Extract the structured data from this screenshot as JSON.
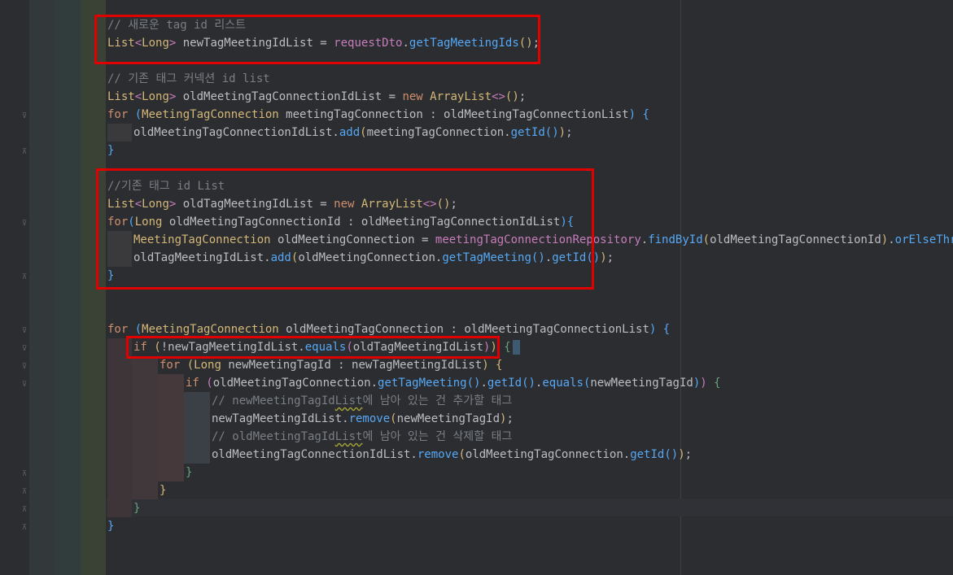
{
  "editor": {
    "lines": [
      {
        "id": "l1",
        "segs": [
          [
            "cmt",
            "// 새로운 tag id 리스트"
          ]
        ]
      },
      {
        "id": "l2",
        "segs": [
          [
            "ylw",
            "List"
          ],
          [
            "br2",
            "<"
          ],
          [
            "ylw",
            "Long"
          ],
          [
            "br2",
            "> "
          ],
          [
            "pl",
            "newTagMeetingIdList = "
          ],
          [
            "fld",
            "requestDto"
          ],
          [
            "pl",
            "."
          ],
          [
            "fn",
            "getTagMeetingIds"
          ],
          [
            "br1",
            "()"
          ],
          [
            "pl",
            ";"
          ]
        ]
      },
      {
        "id": "l3",
        "segs": []
      },
      {
        "id": "l4",
        "segs": [
          [
            "cmt",
            "// 기존 태그 커넥션 id list"
          ]
        ]
      },
      {
        "id": "l5",
        "segs": [
          [
            "ylw",
            "List"
          ],
          [
            "br2",
            "<"
          ],
          [
            "ylw",
            "Long"
          ],
          [
            "br2",
            "> "
          ],
          [
            "pl",
            "oldMeetingTagConnectionIdList = "
          ],
          [
            "kw",
            "new "
          ],
          [
            "ylw",
            "ArrayList"
          ],
          [
            "br2",
            "<>"
          ],
          [
            "br1",
            "()"
          ],
          [
            "pl",
            ";"
          ]
        ]
      },
      {
        "id": "l6",
        "segs": [
          [
            "kw",
            "for "
          ],
          [
            "br3",
            "("
          ],
          [
            "ylw",
            "MeetingTagConnection "
          ],
          [
            "pl",
            "meetingTagConnection : oldMeetingTagConnectionList"
          ],
          [
            "br3",
            ") "
          ],
          [
            "br3",
            "{"
          ]
        ]
      },
      {
        "id": "l7",
        "segs": [
          [
            "pl",
            "oldMeetingTagConnectionIdList."
          ],
          [
            "fn",
            "add"
          ],
          [
            "br1",
            "("
          ],
          [
            "pl",
            "meetingTagConnection."
          ],
          [
            "fn",
            "getId"
          ],
          [
            "br3",
            "()"
          ],
          [
            "br1",
            ")"
          ],
          [
            "pl",
            ";"
          ]
        ]
      },
      {
        "id": "l8",
        "segs": [
          [
            "br3",
            "}"
          ]
        ]
      },
      {
        "id": "l9",
        "segs": []
      },
      {
        "id": "l10",
        "segs": [
          [
            "cmt",
            "//기존 태그 id List"
          ]
        ]
      },
      {
        "id": "l11",
        "segs": [
          [
            "ylw",
            "List"
          ],
          [
            "br2",
            "<"
          ],
          [
            "ylw",
            "Long"
          ],
          [
            "br2",
            "> "
          ],
          [
            "pl",
            "oldTagMeetingIdList = "
          ],
          [
            "kw",
            "new "
          ],
          [
            "ylw",
            "ArrayList"
          ],
          [
            "br2",
            "<>"
          ],
          [
            "br1",
            "()"
          ],
          [
            "pl",
            ";"
          ]
        ]
      },
      {
        "id": "l12",
        "segs": [
          [
            "kw",
            "for"
          ],
          [
            "br3",
            "("
          ],
          [
            "ylw",
            "Long "
          ],
          [
            "pl",
            "oldMeetingTagConnectionId : oldMeetingTagConnectionIdList"
          ],
          [
            "br3",
            ")"
          ],
          [
            "br3",
            "{"
          ]
        ]
      },
      {
        "id": "l13",
        "segs": [
          [
            "ylw",
            "MeetingTagConnection "
          ],
          [
            "pl",
            "oldMeetingConnection = "
          ],
          [
            "fld",
            "meetingTagConnectionRepository"
          ],
          [
            "pl",
            "."
          ],
          [
            "fn",
            "findById"
          ],
          [
            "br1",
            "("
          ],
          [
            "pl",
            "oldMeetingTagConnectionId"
          ],
          [
            "br1",
            ")"
          ],
          [
            "pl",
            "."
          ],
          [
            "fn",
            "orElseThrow"
          ],
          [
            "br1",
            "()"
          ],
          [
            "pl",
            ";"
          ]
        ]
      },
      {
        "id": "l14",
        "segs": [
          [
            "pl",
            "oldTagMeetingIdList."
          ],
          [
            "fn",
            "add"
          ],
          [
            "br1",
            "("
          ],
          [
            "pl",
            "oldMeetingConnection."
          ],
          [
            "fn",
            "getTagMeeting"
          ],
          [
            "br3",
            "()"
          ],
          [
            "pl",
            "."
          ],
          [
            "fn",
            "getId"
          ],
          [
            "br3",
            "()"
          ],
          [
            "br1",
            ")"
          ],
          [
            "pl",
            ";"
          ]
        ]
      },
      {
        "id": "l15",
        "segs": [
          [
            "br3",
            "}"
          ]
        ]
      },
      {
        "id": "l16",
        "segs": []
      },
      {
        "id": "l17",
        "segs": []
      },
      {
        "id": "l18",
        "segs": [
          [
            "kw",
            "for "
          ],
          [
            "br3",
            "("
          ],
          [
            "ylw",
            "MeetingTagConnection "
          ],
          [
            "pl",
            "oldMeetingTagConnection : oldMeetingTagConnectionList"
          ],
          [
            "br3",
            ") "
          ],
          [
            "br3",
            "{"
          ]
        ]
      },
      {
        "id": "l19",
        "segs": [
          [
            "kw",
            "if "
          ],
          [
            "br1",
            "("
          ],
          [
            "pl",
            "!newTagMeetingIdList."
          ],
          [
            "fn",
            "equals"
          ],
          [
            "br2",
            "("
          ],
          [
            "pl",
            "oldTagMeetingIdList"
          ],
          [
            "br2",
            ")"
          ],
          [
            "br1",
            ") "
          ],
          [
            "br4",
            "{"
          ]
        ]
      },
      {
        "id": "l20",
        "segs": [
          [
            "kw",
            "for "
          ],
          [
            "br1",
            "("
          ],
          [
            "ylw",
            "Long "
          ],
          [
            "pl",
            "newMeetingTagId : newTagMeetingIdList"
          ],
          [
            "br1",
            ") "
          ],
          [
            "br1",
            "{"
          ]
        ]
      },
      {
        "id": "l21",
        "segs": [
          [
            "kw",
            "if "
          ],
          [
            "br2",
            "("
          ],
          [
            "pl",
            "oldMeetingTagConnection."
          ],
          [
            "fn",
            "getTagMeeting"
          ],
          [
            "br3",
            "()"
          ],
          [
            "pl",
            "."
          ],
          [
            "fn",
            "getId"
          ],
          [
            "br3",
            "()"
          ],
          [
            "pl",
            "."
          ],
          [
            "fn",
            "equals"
          ],
          [
            "br3",
            "("
          ],
          [
            "pl",
            "newMeetingTagId"
          ],
          [
            "br3",
            ")"
          ],
          [
            "br2",
            ") "
          ],
          [
            "br4",
            "{"
          ]
        ]
      },
      {
        "id": "l22",
        "segs": [
          [
            "cmt",
            "// newMeetingTagId"
          ],
          [
            "cmtw",
            "List"
          ],
          [
            "cmt",
            "에 남아 있는 건 추가할 태그"
          ]
        ]
      },
      {
        "id": "l23",
        "segs": [
          [
            "pl",
            "newTagMeetingIdList."
          ],
          [
            "fn",
            "remove"
          ],
          [
            "br1",
            "("
          ],
          [
            "pl",
            "newMeetingTagId"
          ],
          [
            "br1",
            ")"
          ],
          [
            "pl",
            ";"
          ]
        ]
      },
      {
        "id": "l24",
        "segs": [
          [
            "cmt",
            "// oldMeetingTagId"
          ],
          [
            "cmtw",
            "List"
          ],
          [
            "cmt",
            "에 남아 있는 건 삭제할 태그"
          ]
        ]
      },
      {
        "id": "l25",
        "segs": [
          [
            "pl",
            "oldMeetingTagConnectionIdList."
          ],
          [
            "fn",
            "remove"
          ],
          [
            "br1",
            "("
          ],
          [
            "pl",
            "oldMeetingTagConnection."
          ],
          [
            "fn",
            "getId"
          ],
          [
            "br3",
            "()"
          ],
          [
            "br1",
            ")"
          ],
          [
            "pl",
            ";"
          ]
        ]
      },
      {
        "id": "l26",
        "segs": [
          [
            "br4",
            "}"
          ]
        ]
      },
      {
        "id": "l27",
        "segs": [
          [
            "br1",
            "}"
          ]
        ]
      },
      {
        "id": "l28",
        "segs": [
          [
            "br4",
            "}"
          ]
        ]
      },
      {
        "id": "l29",
        "segs": [
          [
            "br3",
            "}"
          ]
        ]
      }
    ]
  },
  "colors": {
    "background": "#2b2d30",
    "comment": "#7a7e85",
    "keyword": "#cf8e6d",
    "type": "#d5b778",
    "method": "#56a8f5",
    "field": "#c77dbb",
    "highlight_box": "#e00000"
  },
  "icons": {
    "fold": "fold-marker-icon",
    "fold_end": "fold-end-icon"
  }
}
